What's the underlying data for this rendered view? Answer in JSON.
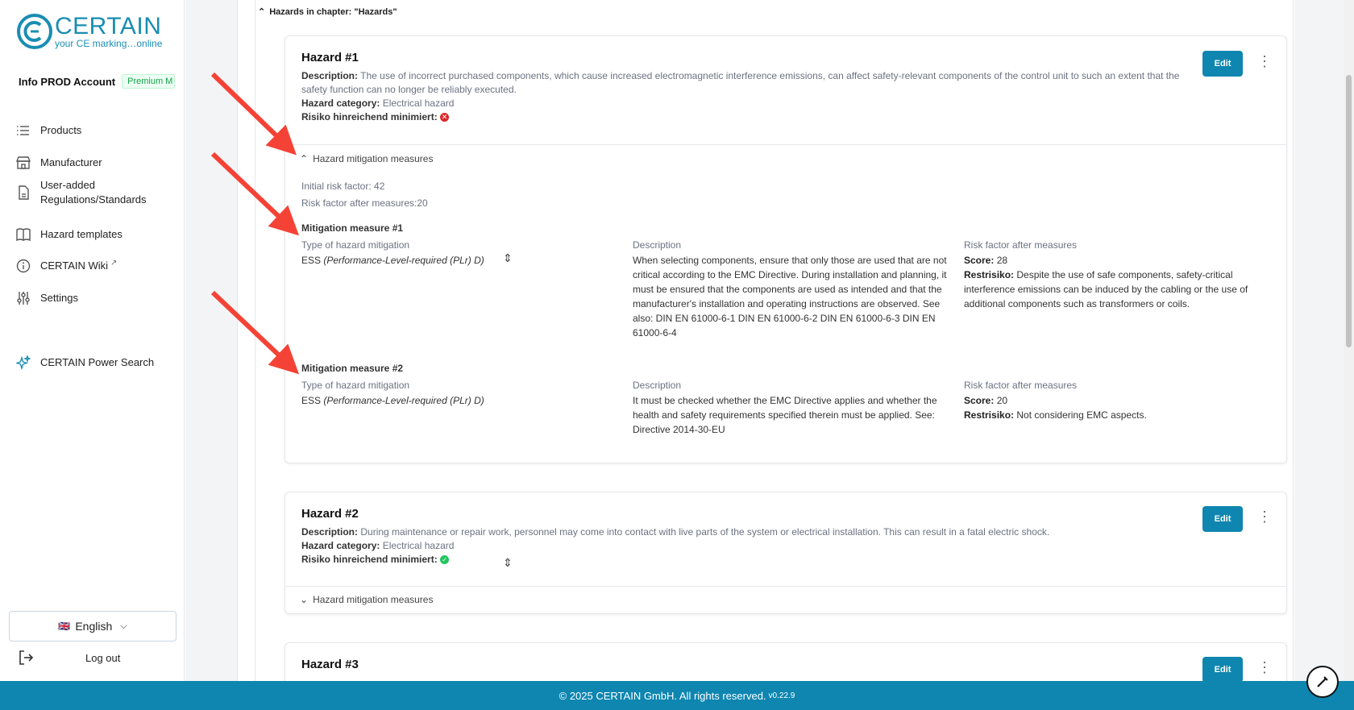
{
  "brand": {
    "name": "CERTAIN",
    "tagline": "your CE marking…online",
    "color": "#1a8db2"
  },
  "account": {
    "name": "Info PROD Account",
    "badge": "Premium M"
  },
  "nav": [
    {
      "label": "Products",
      "icon": "list-icon"
    },
    {
      "label": "Manufacturer",
      "icon": "store-icon"
    },
    {
      "label": "User-added Regulations/Standards",
      "icon": "document-icon"
    },
    {
      "label": "Hazard templates",
      "icon": "book-icon"
    },
    {
      "label": "CERTAIN Wiki",
      "icon": "info-icon"
    },
    {
      "label": "Settings",
      "icon": "sliders-icon"
    },
    {
      "label": "CERTAIN Power Search",
      "icon": "sparkle-icon"
    }
  ],
  "language": {
    "flag": "🇬🇧",
    "label": "English"
  },
  "logout": "Log out",
  "chapter": {
    "header": "Hazards in chapter: \"Hazards\""
  },
  "hazards": [
    {
      "title": "Hazard #1",
      "description_label": "Description:",
      "description": "The use of incorrect purchased components, which cause increased electromagnetic interference emissions, can affect safety-relevant components of the control unit to such an extent that the safety function can no longer be reliably executed.",
      "category_label": "Hazard category:",
      "category": "Electrical hazard",
      "risk_label": "Risiko hinreichend minimiert:",
      "risk_ok": false,
      "edit": "Edit",
      "mitigation_toggle": "Hazard mitigation measures",
      "initial_risk": "Initial risk factor: 42",
      "risk_after": "Risk factor after measures:20",
      "measures": [
        {
          "title": "Mitigation measure #1",
          "type_header": "Type of hazard mitigation",
          "type_prefix": "ESS",
          "type_detail": "(Performance-Level-required (PLr) D)",
          "desc_header": "Description",
          "description": "When selecting components, ensure that only those are used that are not critical according to the EMC Directive. During installation and planning, it must be ensured that the components are used as intended and that the manufacturer's installation and operating instructions are observed. See also: DIN EN 61000-6-1 DIN EN 61000-6-2 DIN EN 61000-6-3 DIN EN 61000-6-4",
          "risk_header": "Risk factor after measures",
          "score_label": "Score:",
          "score": "28",
          "rest_label": "Restrisiko:",
          "rest": "Despite the use of safe components, safety-critical interference emissions can be induced by the cabling or the use of additional components such as transformers or coils."
        },
        {
          "title": "Mitigation measure #2",
          "type_header": "Type of hazard mitigation",
          "type_prefix": "ESS",
          "type_detail": "(Performance-Level-required (PLr) D)",
          "desc_header": "Description",
          "description": "It must be checked whether the EMC Directive applies and whether the health and safety requirements specified therein must be applied. See: Directive 2014-30-EU",
          "risk_header": "Risk factor after measures",
          "score_label": "Score:",
          "score": "20",
          "rest_label": "Restrisiko:",
          "rest": "Not considering EMC aspects."
        }
      ]
    },
    {
      "title": "Hazard #2",
      "description_label": "Description:",
      "description": "During maintenance or repair work, personnel may come into contact with live parts of the system or electrical installation. This can result in a fatal electric shock.",
      "category_label": "Hazard category:",
      "category": "Electrical hazard",
      "risk_label": "Risiko hinreichend minimiert:",
      "risk_ok": true,
      "edit": "Edit",
      "mitigation_toggle": "Hazard mitigation measures"
    },
    {
      "title": "Hazard #3",
      "edit": "Edit"
    }
  ],
  "footer": {
    "text": "© 2025 CERTAIN GmbH. All rights reserved.",
    "version": "v0.22.9"
  },
  "colors": {
    "primary": "#0e86b0",
    "danger": "#dc2626",
    "success": "#22c55e",
    "annotation_arrow": "#f44336"
  }
}
